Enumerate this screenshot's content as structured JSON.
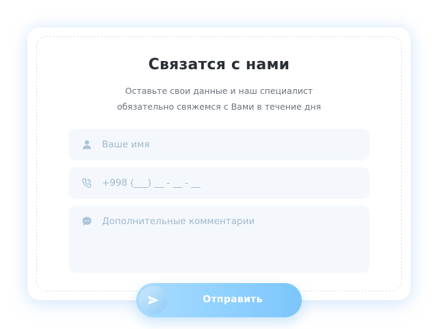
{
  "form": {
    "title": "Связатся с нами",
    "subtitle_line1": "Оставьте свои данные и наш специалист",
    "subtitle_line2": "обязательно свяжемся с Вами в течение дня",
    "name_field": {
      "placeholder": "Ваше имя",
      "icon": "user-icon"
    },
    "phone_field": {
      "placeholder": "+998 (___) __ - __ - __",
      "icon": "phone-icon"
    },
    "comment_field": {
      "placeholder": "Дополнительные комментарии",
      "icon": "chat-icon"
    },
    "submit": {
      "label": "Отправить",
      "icon": "send-icon"
    }
  },
  "colors": {
    "title": "#2b2f36",
    "subtitle": "#6c737c",
    "field_bg": "#f4f8fd",
    "placeholder": "#9fb7cc",
    "icon": "#a9c3d8",
    "button_start": "#a9dcff",
    "button_end": "#7cc6fb"
  }
}
